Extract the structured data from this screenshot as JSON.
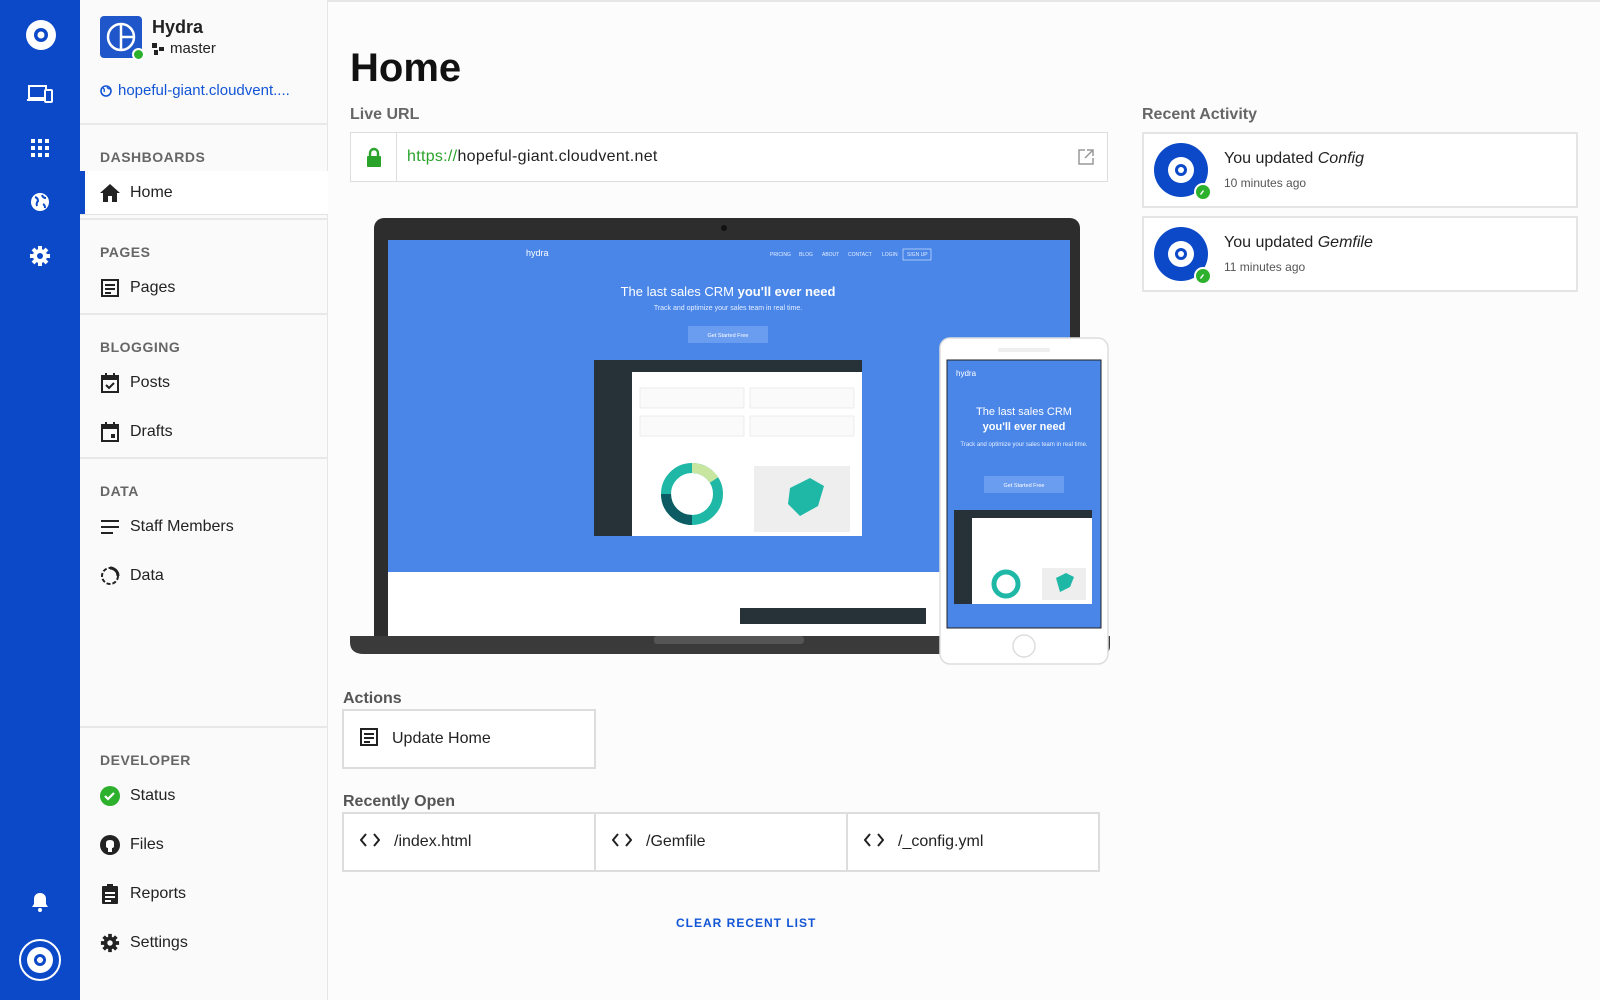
{
  "rail": {
    "icons": [
      "cloud-logo-icon",
      "devices-icon",
      "apps-grid-icon",
      "globe-icon",
      "gear-icon",
      "bell-icon",
      "account-logo-icon"
    ]
  },
  "site": {
    "name": "Hydra",
    "branch": "master",
    "url": "hopeful-giant.cloudvent...."
  },
  "sidebar": {
    "dashboards": {
      "title": "DASHBOARDS",
      "items": [
        {
          "label": "Home"
        }
      ]
    },
    "pages": {
      "title": "PAGES",
      "items": [
        {
          "label": "Pages"
        }
      ]
    },
    "blogging": {
      "title": "BLOGGING",
      "items": [
        {
          "label": "Posts"
        },
        {
          "label": "Drafts"
        }
      ]
    },
    "data": {
      "title": "DATA",
      "items": [
        {
          "label": "Staff Members"
        },
        {
          "label": "Data"
        }
      ]
    },
    "developer": {
      "title": "DEVELOPER",
      "items": [
        {
          "label": "Status"
        },
        {
          "label": "Files"
        },
        {
          "label": "Reports"
        },
        {
          "label": "Settings"
        }
      ]
    }
  },
  "main": {
    "title": "Home",
    "live_url_label": "Live URL",
    "live_url_protocol": "https://",
    "live_url_host": "hopeful-giant.cloudvent.net",
    "preview": {
      "brand": "hydra",
      "nav": [
        "PRICING",
        "BLOG",
        "ABOUT",
        "CONTACT",
        "LOGIN",
        "SIGN UP"
      ],
      "headline_a": "The last sales CRM ",
      "headline_b": "you'll ever need",
      "mobile_headline_a": "The last sales CRM",
      "mobile_headline_b": "you'll ever need",
      "subline": "Track and optimize your sales team in real time.",
      "cta": "Get Started Free"
    },
    "actions_label": "Actions",
    "actions": [
      {
        "label": "Update Home"
      }
    ],
    "recent_label": "Recently Open",
    "recent": [
      {
        "label": "/index.html"
      },
      {
        "label": "/Gemfile"
      },
      {
        "label": "/_config.yml"
      }
    ],
    "clear_label": "CLEAR RECENT LIST"
  },
  "activity": {
    "title": "Recent Activity",
    "items": [
      {
        "prefix": "You updated ",
        "target": "Config",
        "time": "10 minutes ago"
      },
      {
        "prefix": "You updated ",
        "target": "Gemfile",
        "time": "11 minutes ago"
      }
    ]
  },
  "colors": {
    "brand": "#0c49c8",
    "link": "#1255d6",
    "success": "#2db12d",
    "preview_bg": "#4a86e8"
  }
}
